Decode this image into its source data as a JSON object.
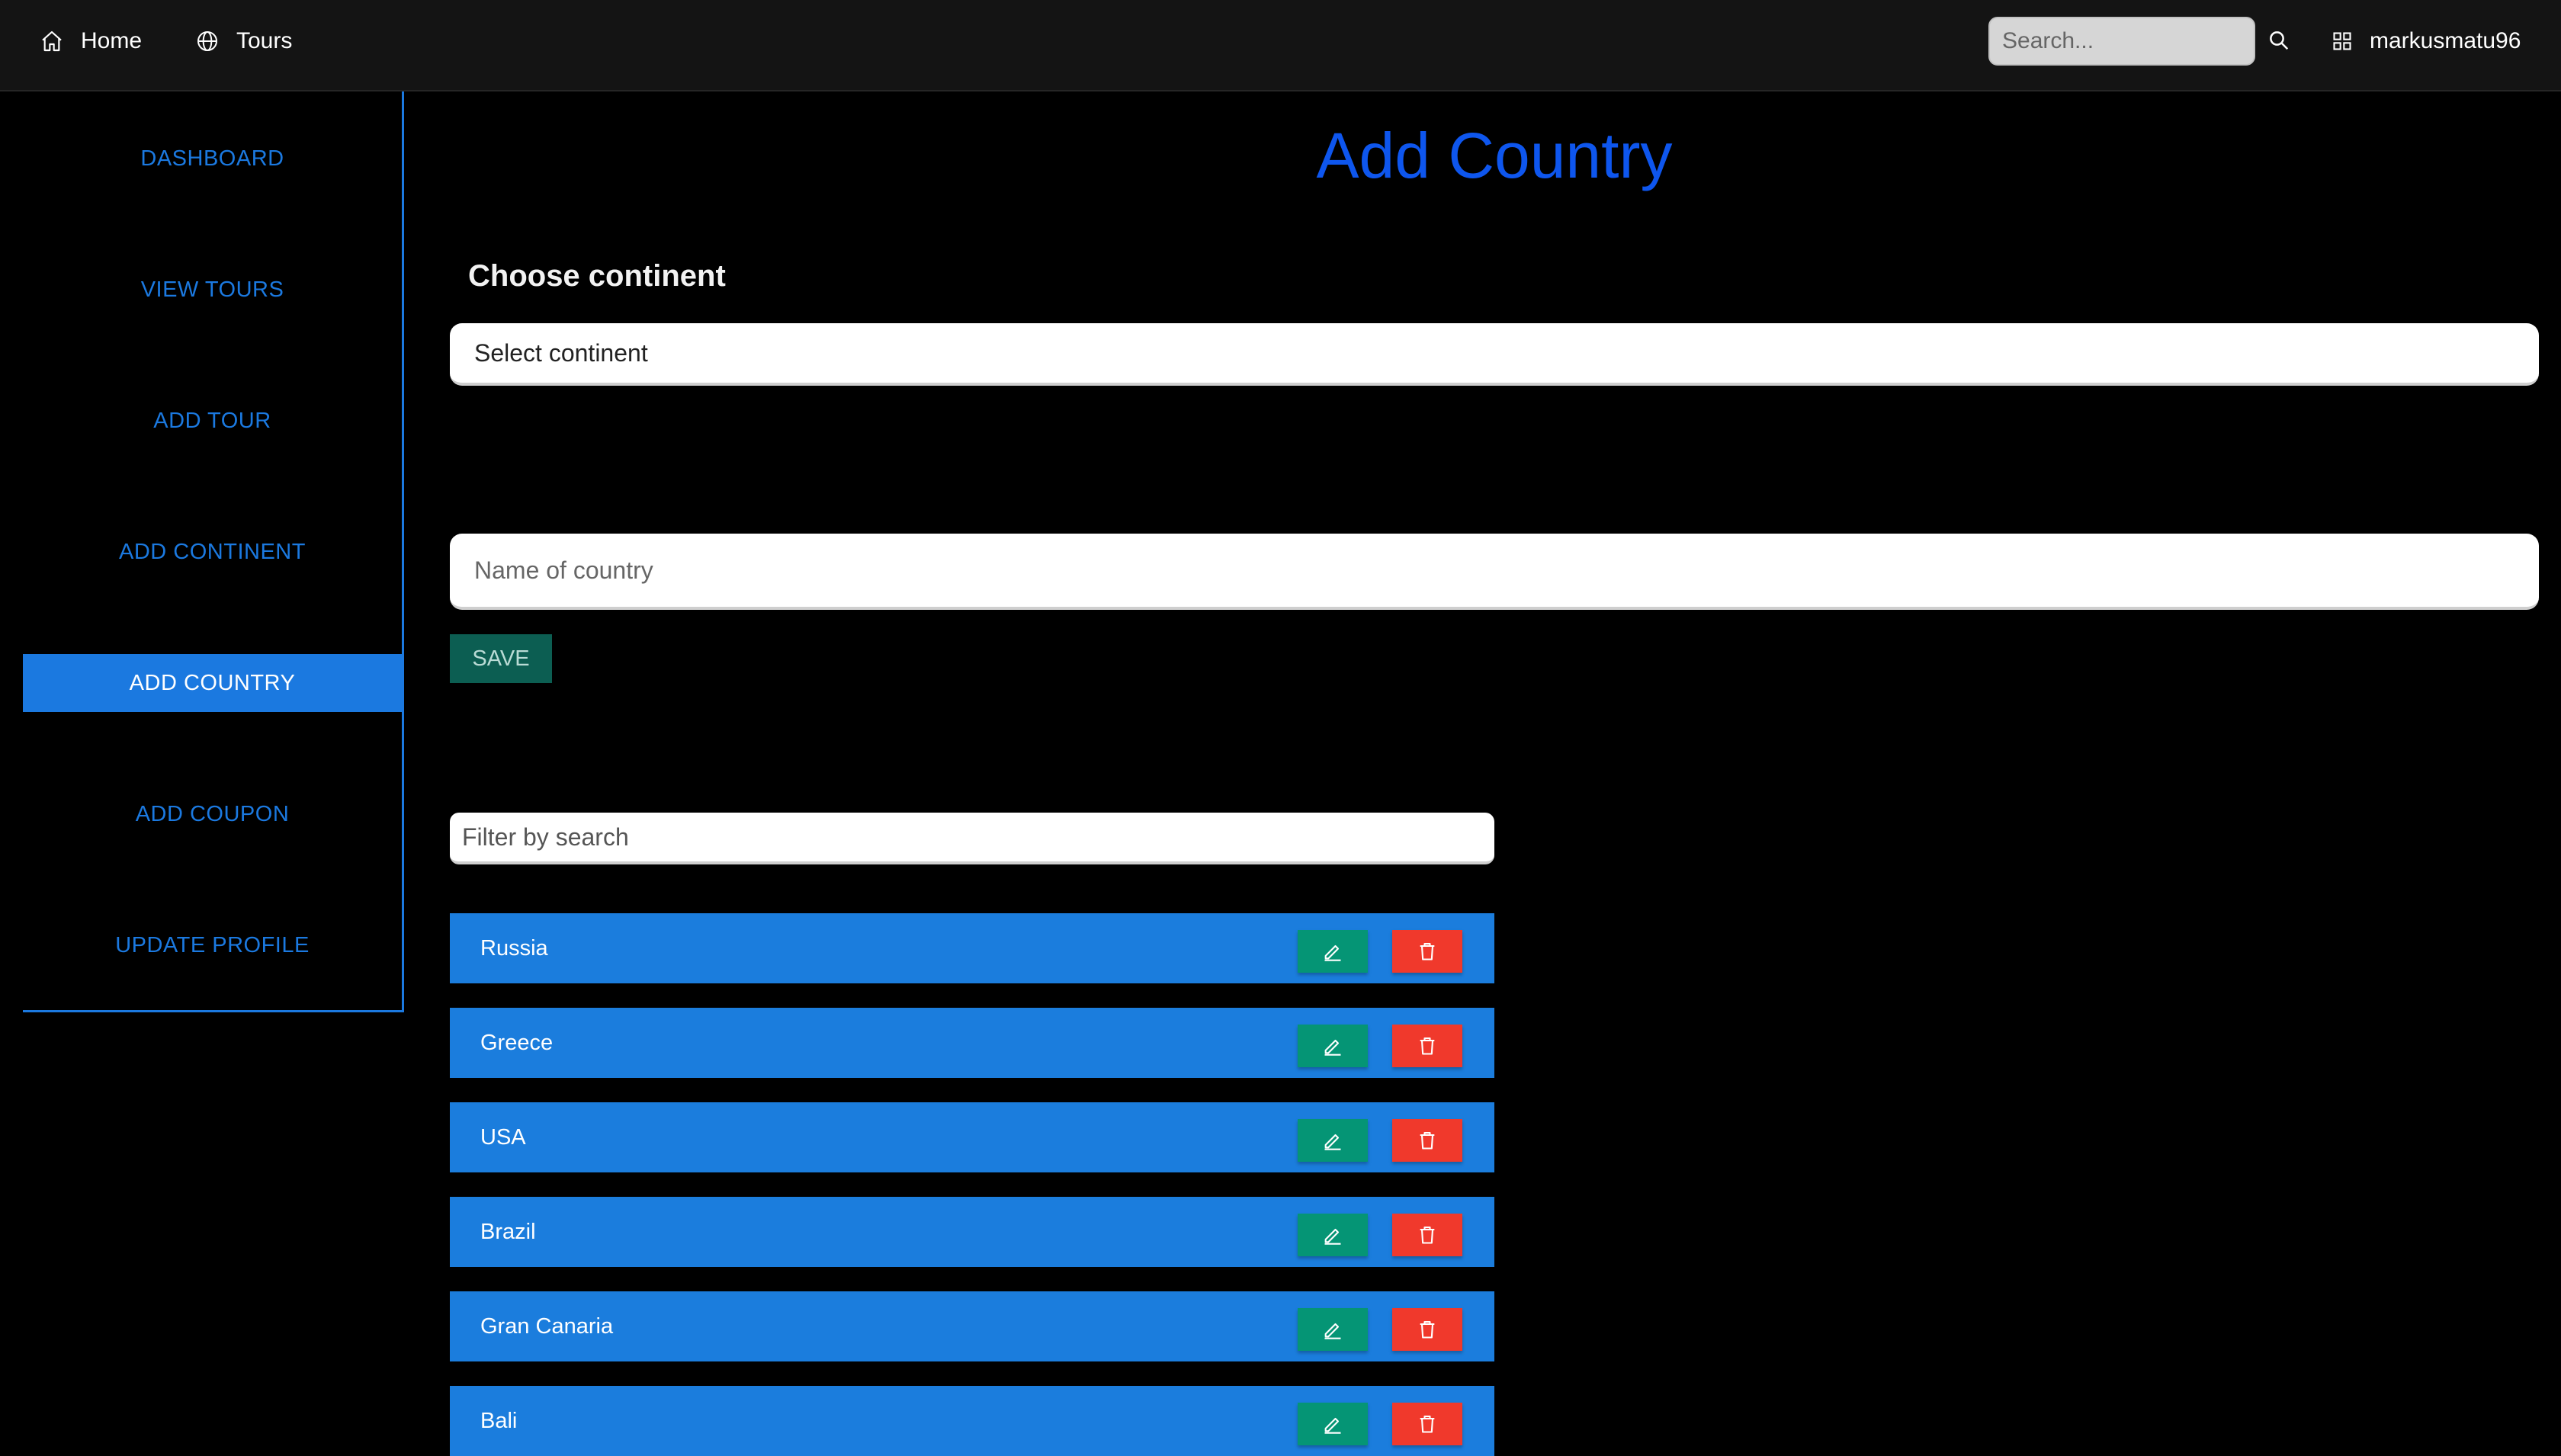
{
  "navbar": {
    "home_label": "Home",
    "tours_label": "Tours",
    "search_placeholder": "Search...",
    "username": "markusmatu96"
  },
  "sidebar": {
    "items": [
      {
        "label": "DASHBOARD",
        "active": false
      },
      {
        "label": "VIEW TOURS",
        "active": false
      },
      {
        "label": "ADD TOUR",
        "active": false
      },
      {
        "label": "ADD CONTINENT",
        "active": false
      },
      {
        "label": "ADD COUNTRY",
        "active": true
      },
      {
        "label": "ADD COUPON",
        "active": false
      },
      {
        "label": "UPDATE PROFILE",
        "active": false
      }
    ]
  },
  "main": {
    "title": "Add Country",
    "continent_label": "Choose continent",
    "continent_select": "Select continent",
    "country_placeholder": "Name of country",
    "save_label": "SAVE",
    "filter_placeholder": "Filter by search",
    "countries": [
      "Russia",
      "Greece",
      "USA",
      "Brazil",
      "Gran Canaria",
      "Bali"
    ]
  },
  "colors": {
    "accent": "#1b79e0",
    "title": "#0e56ee",
    "edit": "#059575",
    "delete": "#f0392c",
    "save": "#0c5e52"
  }
}
